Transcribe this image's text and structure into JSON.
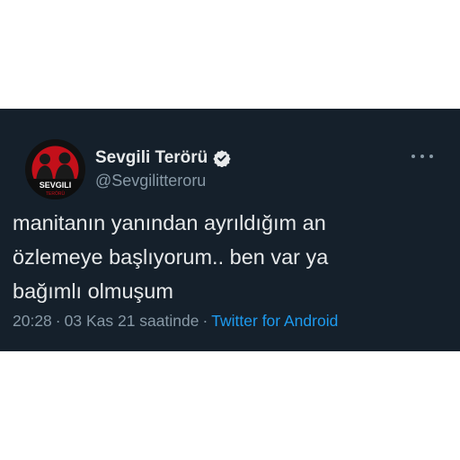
{
  "tweet": {
    "author": {
      "display_name": "Sevgili Terörü",
      "username": "@Sevgilitteroru",
      "verified": true,
      "avatar_text": "SEVGILI",
      "avatar_subtext": "TERÖRÜ"
    },
    "text": "manitanın yanından ayrıldığım an\nözlemeye başlıyorum.. ben var ya\nbağımlı olmuşum",
    "time": "20:28",
    "separator": "·",
    "date": "03 Kas 21 saatinde",
    "source": "Twitter for Android",
    "more_icon": "more-horizontal-icon"
  },
  "colors": {
    "background": "#15202b",
    "text": "#e7e9ea",
    "muted": "#8899a6",
    "link": "#1d9bf0",
    "avatar_accent": "#d0121b"
  }
}
